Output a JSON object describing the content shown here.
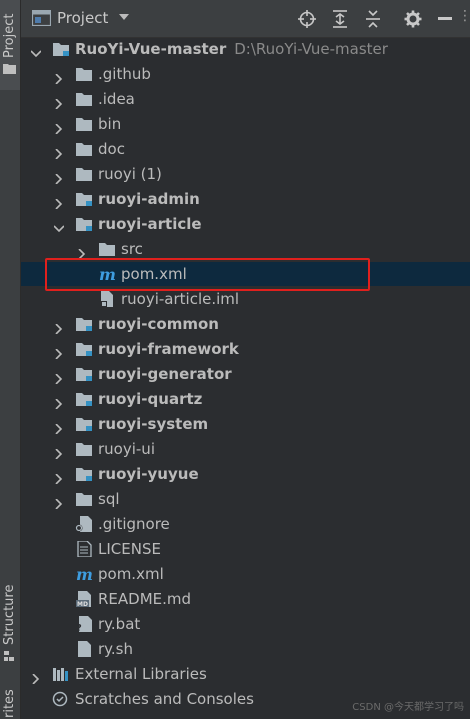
{
  "sidebar": {
    "project_tab": "Project",
    "structure_tab": "Structure",
    "favorites_tab": "rites"
  },
  "header": {
    "title": "Project",
    "cut_off_icon": "overflow-glyph"
  },
  "tree": {
    "root": {
      "label": "RuoYi-Vue-master",
      "path": "D:\\RuoYi-Vue-master"
    },
    "items": [
      {
        "label": ".github"
      },
      {
        "label": ".idea"
      },
      {
        "label": "bin"
      },
      {
        "label": "doc"
      },
      {
        "label": "ruoyi (1)"
      },
      {
        "label": "ruoyi-admin"
      },
      {
        "label": "ruoyi-article"
      },
      {
        "label": "src"
      },
      {
        "label": "pom.xml"
      },
      {
        "label": "ruoyi-article.iml"
      },
      {
        "label": "ruoyi-common"
      },
      {
        "label": "ruoyi-framework"
      },
      {
        "label": "ruoyi-generator"
      },
      {
        "label": "ruoyi-quartz"
      },
      {
        "label": "ruoyi-system"
      },
      {
        "label": "ruoyi-ui"
      },
      {
        "label": "ruoyi-yuyue"
      },
      {
        "label": "sql"
      },
      {
        "label": ".gitignore"
      },
      {
        "label": "LICENSE"
      },
      {
        "label": "pom.xml"
      },
      {
        "label": "README.md"
      },
      {
        "label": "ry.bat"
      },
      {
        "label": "ry.sh"
      }
    ],
    "external_libraries": "External Libraries",
    "scratches": "Scratches and Consoles"
  },
  "watermark": "CSDN @今天都学习了吗",
  "colors": {
    "background": "#2b2d30",
    "selection": "#0d293e",
    "highlight_border": "#e0201d",
    "maven_icon": "#3e9de0"
  }
}
